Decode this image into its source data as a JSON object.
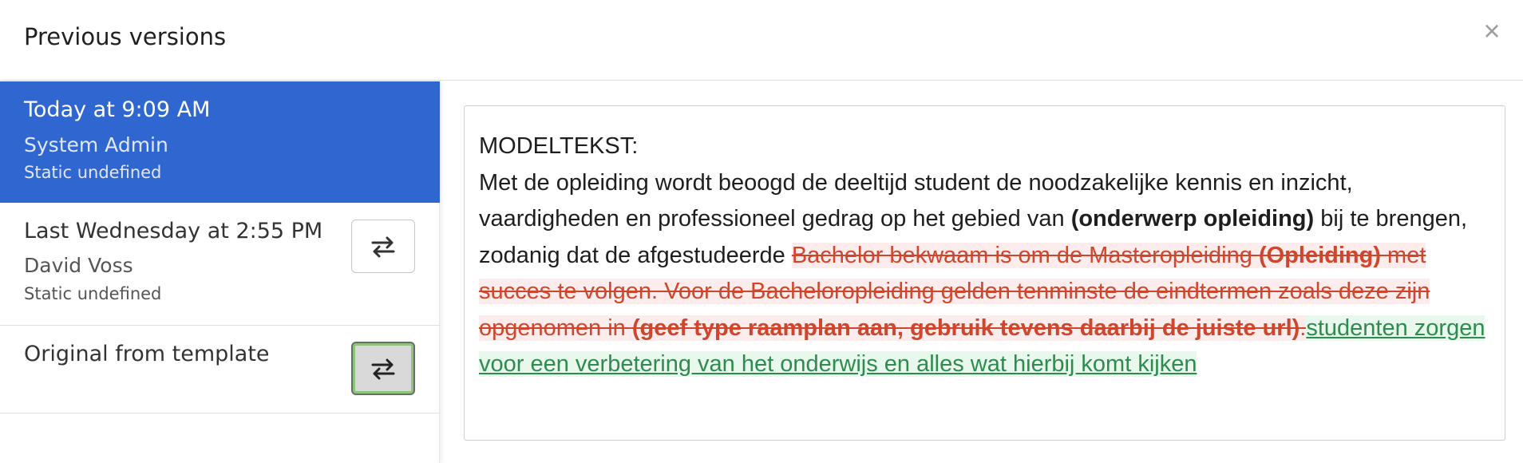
{
  "header": {
    "title": "Previous versions",
    "close_label": "×"
  },
  "versions": [
    {
      "title": "Today at 9:09 AM",
      "author": "System Admin",
      "note": "Static undefined",
      "selected": true
    },
    {
      "title": "Last Wednesday at 2:55 PM",
      "author": "David Voss",
      "note": "Static undefined",
      "selected": false
    },
    {
      "title": "Original from template",
      "selected": false
    }
  ],
  "compare_icon": "swap-arrows-icon",
  "colors": {
    "selected_bg": "#2f66d0",
    "deleted_text": "#d0462d",
    "deleted_bg": "#fdecec",
    "inserted_text": "#2e8b4e",
    "inserted_bg": "#e9f8ec"
  },
  "document": {
    "heading": "MODELTEKST:",
    "p1": "Met de opleiding wordt beoogd de deeltijd student de noodzakelijke kennis en inzicht, vaardigheden en professioneel gedrag op het gebied van ",
    "p1_bold": "(onderwerp opleiding)",
    "p2": " bij te brengen, zodanig dat de afgestudeerde ",
    "del1": "Bachelor bekwaam is om de Masteropleiding ",
    "del1_bold": "(Opleiding)",
    "del2": " met succes te volgen. Voor de Bacheloropleiding gelden tenminste de eindtermen zoals deze zijn opgenomen in ",
    "del2_bold": "(geef type raamplan aan, gebruik tevens daarbij de juiste url)",
    "del3": ".",
    "ins1": "studenten zorgen voor een verbetering van het onderwijs en alles wat hierbij komt kijken"
  }
}
